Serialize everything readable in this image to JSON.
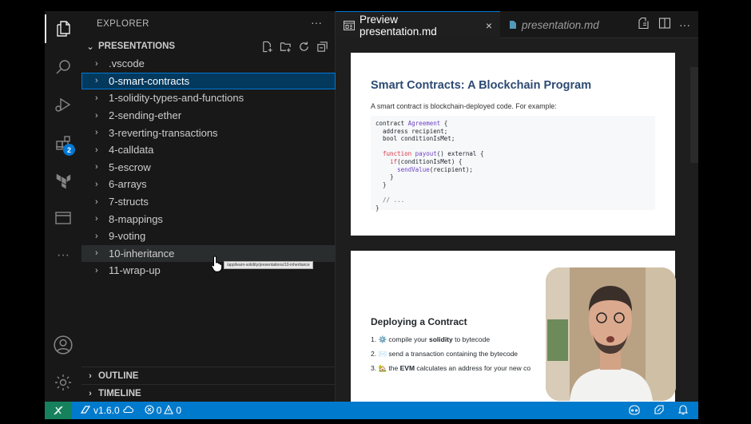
{
  "sidebar": {
    "title": "EXPLORER",
    "more": "···",
    "folder_title": "PRESENTATIONS",
    "items": [
      {
        "label": ".vscode"
      },
      {
        "label": "0-smart-contracts"
      },
      {
        "label": "1-solidity-types-and-functions"
      },
      {
        "label": "2-sending-ether"
      },
      {
        "label": "3-reverting-transactions"
      },
      {
        "label": "4-calldata"
      },
      {
        "label": "5-escrow"
      },
      {
        "label": "6-arrays"
      },
      {
        "label": "7-structs"
      },
      {
        "label": "8-mappings"
      },
      {
        "label": "9-voting"
      },
      {
        "label": "10-inheritance"
      },
      {
        "label": "11-wrap-up"
      }
    ],
    "tooltip": "/app/learn-solidity/presentations/10-inheritance",
    "outline": "OUTLINE",
    "timeline": "TIMELINE"
  },
  "activity": {
    "extensions_badge": "2",
    "more": "···"
  },
  "tabs": {
    "active_label": "Preview presentation.md",
    "inactive_label": "presentation.md",
    "close": "×",
    "more": "···"
  },
  "slide1": {
    "title": "Smart Contracts: A Blockchain Program",
    "intro": "A smart contract is blockchain-deployed code. For example:",
    "code": {
      "l1a": "contract ",
      "l1b": "Agreement",
      "l1c": " {",
      "l2": "  address recipient;",
      "l3": "  bool conditionIsMet;",
      "l5a": "  ",
      "l5b": "function",
      "l5c": " ",
      "l5d": "payout",
      "l5e": "() external {",
      "l6a": "    ",
      "l6b": "if",
      "l6c": "(conditionIsMet) {",
      "l7a": "      ",
      "l7b": "sendValue",
      "l7c": "(recipient);",
      "l8": "    }",
      "l9": "  }",
      "l11": "  // ...",
      "l12": "}"
    }
  },
  "slide2": {
    "title": "Deploying a Contract",
    "steps": {
      "s1_num": "1.",
      "s1_emoji": "⚙️",
      "s1_a": " compile your ",
      "s1_b": "solidity",
      "s1_c": " to bytecode",
      "s2_num": "2.",
      "s2_emoji": "✉️",
      "s2_a": " send a transaction containing the bytecode",
      "s3_num": "3.",
      "s3_emoji": "🏡",
      "s3_a": " the ",
      "s3_b": "EVM",
      "s3_c": " calculates an address for your new co"
    }
  },
  "status": {
    "version": "v1.6.0",
    "errors": "0",
    "warnings": "0"
  },
  "colors": {
    "accent": "#0078d4",
    "status_bar": "#007acc",
    "remote": "#16825d",
    "selection": "#04395e",
    "slide_title": "#2c4a72"
  }
}
